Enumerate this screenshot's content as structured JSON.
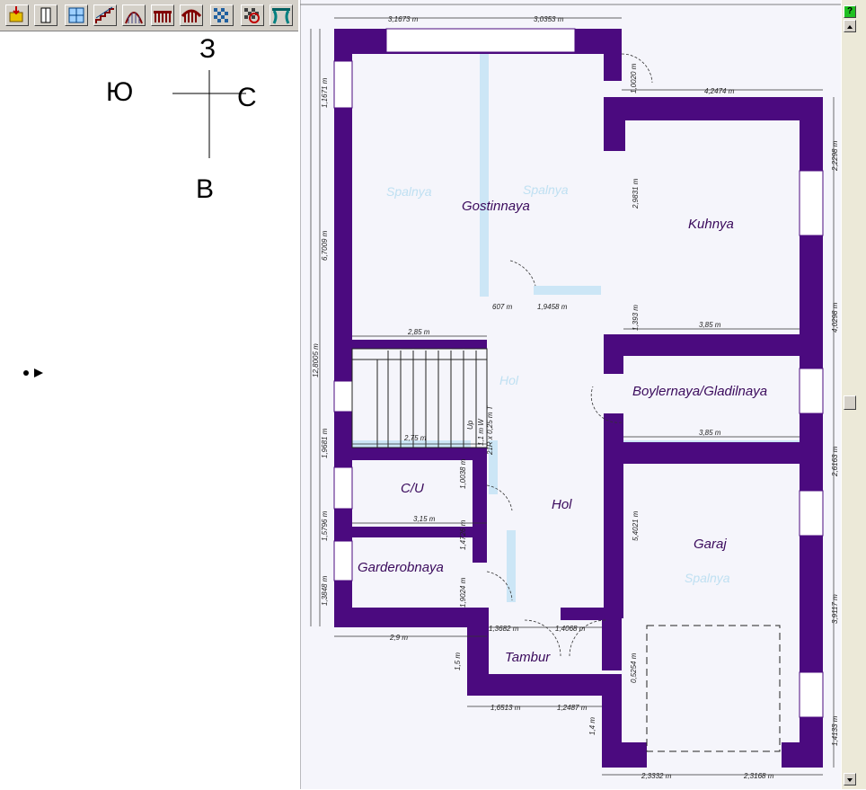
{
  "toolbar": {
    "buttons": [
      {
        "name": "import-icon"
      },
      {
        "name": "door-icon"
      },
      {
        "name": "window-icon"
      },
      {
        "name": "stair-straight-icon"
      },
      {
        "name": "stair-spiral-icon"
      },
      {
        "name": "railing-icon"
      },
      {
        "name": "arch-railing-icon"
      },
      {
        "name": "floor-tile-icon"
      },
      {
        "name": "pattern-icon"
      },
      {
        "name": "curtain-icon"
      }
    ]
  },
  "compass": {
    "north": "З",
    "west": "Ю",
    "east": "С",
    "south": "В"
  },
  "rooms": {
    "gostinnaya": "Gostinnaya",
    "kuhnya": "Kuhnya",
    "boylernaya": "Boylernaya/Gladilnaya",
    "hol1": "Hol",
    "hol2": "Hol",
    "cu": "C/U",
    "garderobnaya": "Garderobnaya",
    "garaj": "Garaj",
    "tambur": "Tambur"
  },
  "ghost_labels": {
    "spalnya1": "Spalnya",
    "spalnya2": "Spalnya",
    "spalnya3": "Spalnya",
    "hol_upper": "Hol"
  },
  "dims": {
    "top_left": "3,1673 m",
    "top_right": "3,0353 m",
    "kuhnya_top": "4,2474 m",
    "right_1": "2,2298 m",
    "right_2": "4,0298 m",
    "right_3": "2,6163 m",
    "right_4": "3,9117 m",
    "right_5": "1,4133 m",
    "left_total": "12,8005 m",
    "left_1": "1,1671 m",
    "left_2": "6,7009 m",
    "left_3": "1,9681 m",
    "left_4": "1,5796 m",
    "left_5": "1,3848 m",
    "w_285": "2,85 m",
    "w_275": "2,75 m",
    "w_315": "3,15 m",
    "w_29": "2,9 m",
    "kuhnya_bottom": "3,85 m",
    "boyler_bottom": "3,85 m",
    "v_29831": "2,9831 m",
    "v_1393": "1,393 m",
    "v_54021": "5,4021 m",
    "h_13682": "1,3682 m",
    "h_14068": "1,4068 m",
    "h_16513": "1,6513 m",
    "h_12487": "1,2487 m",
    "h_23332": "2,3332 m",
    "h_23168": "2,3168 m",
    "v_15": "1,5 m",
    "v_14": "1,4 m",
    "v_10038": "1,0038 m",
    "v_14726": "1,4726 m",
    "v_09": "0,5",
    "v_1020": "1,0020 m",
    "v_05254": "0,5254 m",
    "v_9024": "1,9024 m",
    "stair_w": "1,1 m W",
    "stair_r": "21R x 0,25 m T",
    "up": "Up",
    "hol_607": "607 m",
    "hol_19458": "1,9458 m"
  },
  "help_label": "?"
}
